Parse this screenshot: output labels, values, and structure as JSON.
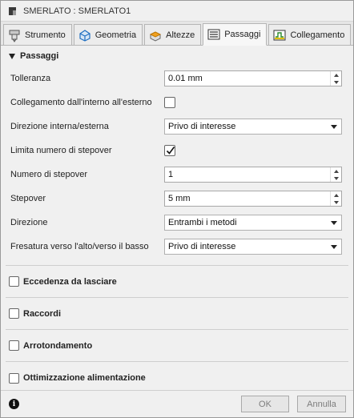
{
  "window": {
    "title": "SMERLATO : SMERLATO1"
  },
  "tabs": [
    {
      "label": "Strumento",
      "icon": "tool-icon"
    },
    {
      "label": "Geometria",
      "icon": "geometry-icon"
    },
    {
      "label": "Altezze",
      "icon": "heights-icon"
    },
    {
      "label": "Passaggi",
      "icon": "passes-icon",
      "active": true
    },
    {
      "label": "Collegamento",
      "icon": "linking-icon"
    }
  ],
  "passes": {
    "header": "Passaggi",
    "tolerance": {
      "label": "Tolleranza",
      "value": "0.01 mm"
    },
    "link_inside_out": {
      "label": "Collegamento dall'interno all'esterno",
      "checked": false
    },
    "direction_in_out": {
      "label": "Direzione interna/esterna",
      "value": "Privo di interesse"
    },
    "limit_stepovers": {
      "label": "Limita numero di stepover",
      "checked": true
    },
    "num_stepovers": {
      "label": "Numero di stepover",
      "value": "1"
    },
    "stepover": {
      "label": "Stepover",
      "value": "5 mm"
    },
    "direction": {
      "label": "Direzione",
      "value": "Entrambi i metodi"
    },
    "milling_updown": {
      "label": "Fresatura verso l'alto/verso il basso",
      "value": "Privo di interesse"
    }
  },
  "sections": [
    {
      "label": "Eccedenza da lasciare",
      "checked": false
    },
    {
      "label": "Raccordi",
      "checked": false
    },
    {
      "label": "Arrotondamento",
      "checked": false
    },
    {
      "label": "Ottimizzazione alimentazione",
      "checked": false
    }
  ],
  "footer": {
    "ok_label": "OK",
    "cancel_label": "Annulla",
    "info_icon": "info-icon"
  },
  "colors": {
    "accent_blue": "#1f6fc1",
    "heights_orange": "#f0a020",
    "link_yellow": "#e0c000"
  }
}
